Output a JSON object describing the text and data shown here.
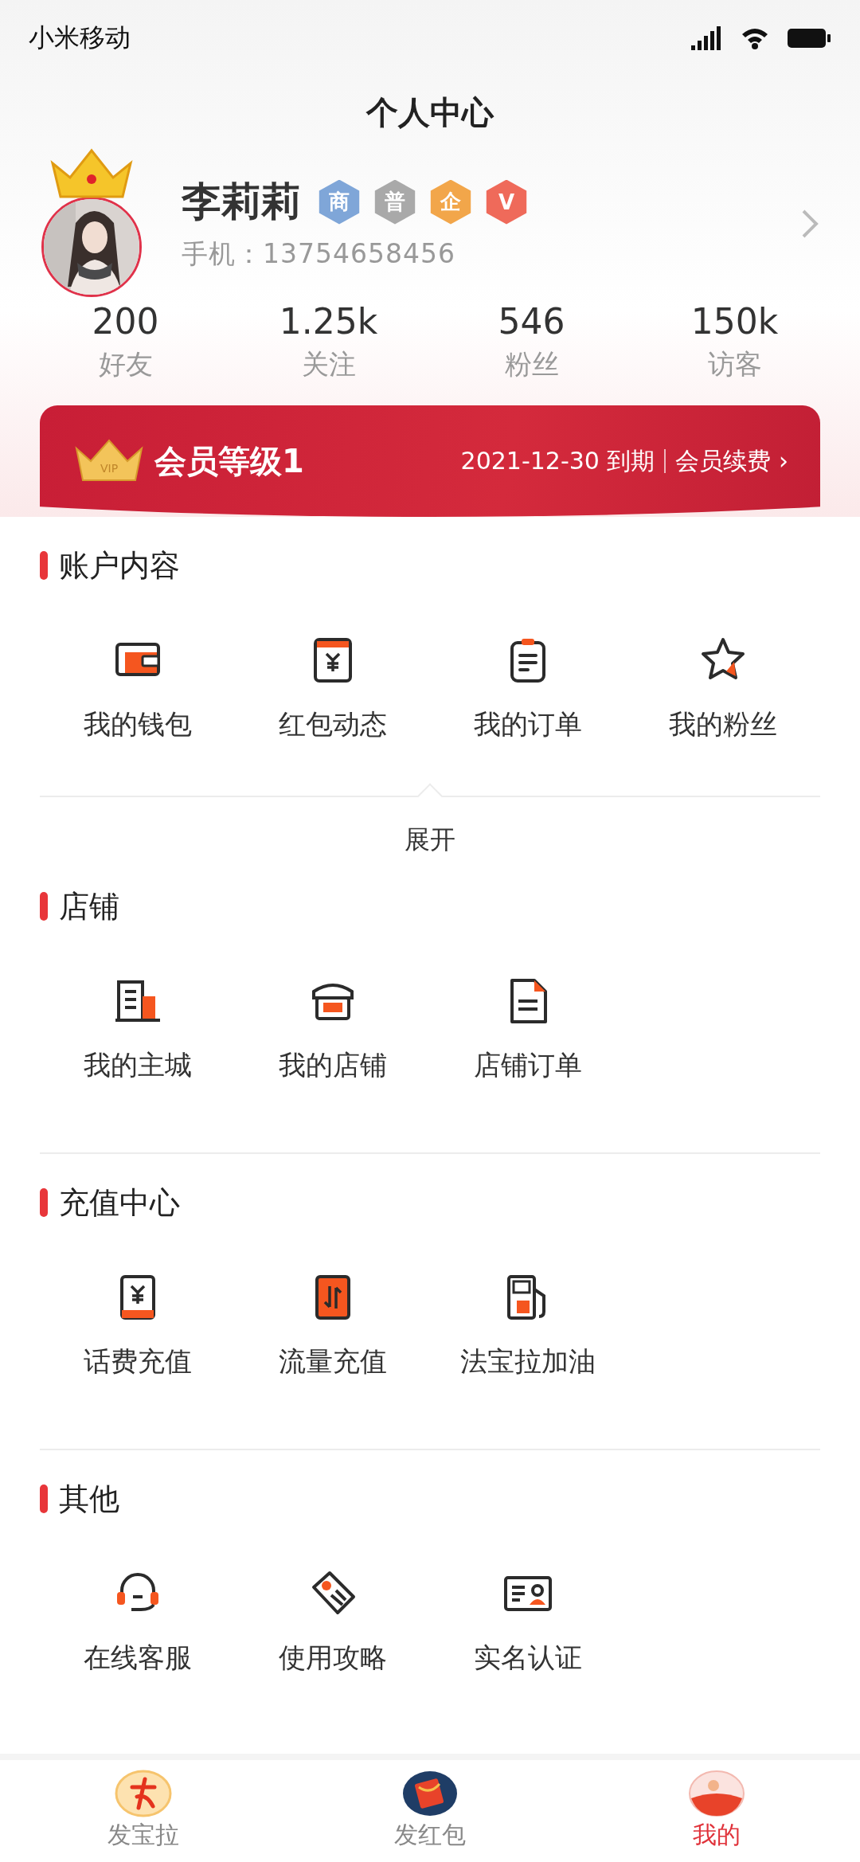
{
  "status_bar": {
    "carrier": "小米移动"
  },
  "header": {
    "title": "个人中心"
  },
  "profile": {
    "name": "李莉莉",
    "phone": "手机：13754658456",
    "badges": [
      {
        "label": "商",
        "color": "#7fa6d8"
      },
      {
        "label": "普",
        "color": "#a9a9a9"
      },
      {
        "label": "企",
        "color": "#f2a64a"
      },
      {
        "label": "V",
        "color": "#ef6a5a"
      }
    ]
  },
  "stats": [
    {
      "value": "200",
      "label": "好友"
    },
    {
      "value": "1.25k",
      "label": "关注"
    },
    {
      "value": "546",
      "label": "粉丝"
    },
    {
      "value": "150k",
      "label": "访客"
    }
  ],
  "membership": {
    "badge": "VIP",
    "level": "会员等级1",
    "expiry": "2021-12-30 到期",
    "renew": "会员续费 ›"
  },
  "sections": [
    {
      "title": "账户内容",
      "items": [
        "我的钱包",
        "红包动态",
        "我的订单",
        "我的粉丝"
      ],
      "expand": "展开"
    },
    {
      "title": "店铺",
      "items": [
        "我的主城",
        "我的店铺",
        "店铺订单"
      ]
    },
    {
      "title": "充值中心",
      "items": [
        "话费充值",
        "流量充值",
        "法宝拉加油"
      ]
    },
    {
      "title": "其他",
      "items": [
        "在线客服",
        "使用攻略",
        "实名认证"
      ]
    }
  ],
  "tab_bar": [
    {
      "label": "发宝拉",
      "selected": false
    },
    {
      "label": "发红包",
      "selected": false
    },
    {
      "label": "我的",
      "selected": true
    }
  ]
}
